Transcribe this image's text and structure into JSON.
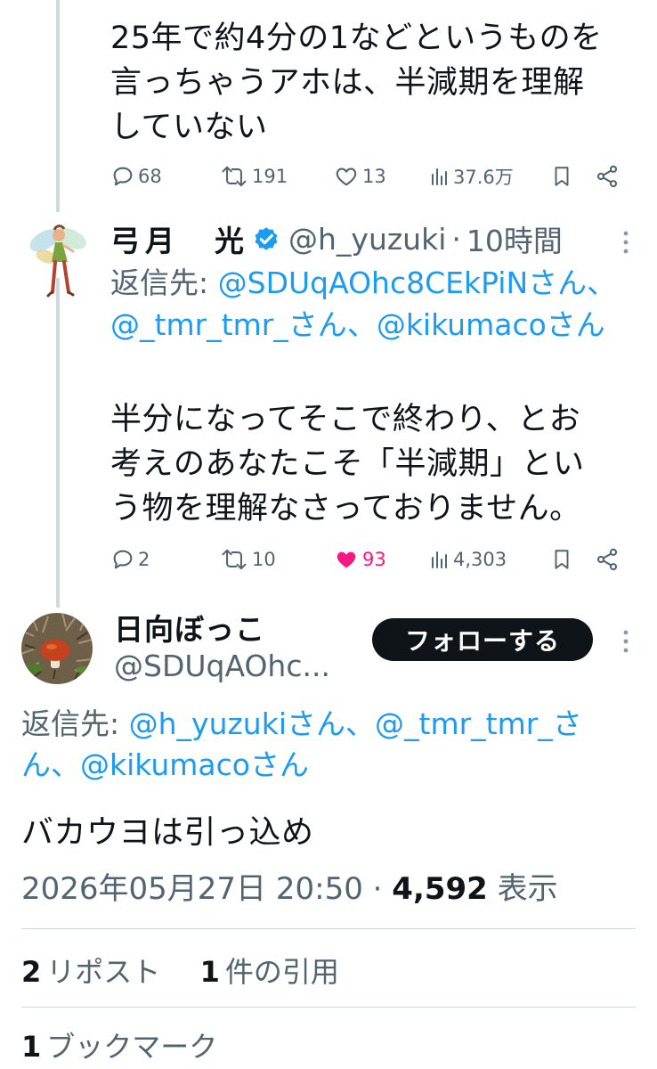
{
  "tweet1": {
    "body_lines": [
      "25年で約4分の1などというものを",
      "言っちゃうアホは、半減期を理解",
      "していない"
    ],
    "replies": "68",
    "reposts": "191",
    "likes": "13",
    "views": "37.6万"
  },
  "tweet2": {
    "name": "弓月　光",
    "handle": "@h_yuzuki",
    "dot": "·",
    "time": "10時間",
    "reply_prefix": "返信先:",
    "reply_mentions": [
      "@SDUqAOhc8CEkPiNさん",
      "@_tmr_tmr_さん",
      "@kikumacoさん"
    ],
    "reply_separator": "、",
    "body_lines": [
      "半分になってそこで終わり、とお",
      "考えのあなたこそ「半減期」とい",
      "う物を理解なさっておりません。"
    ],
    "replies": "2",
    "reposts": "10",
    "likes": "93",
    "views": "4,303"
  },
  "tweet3": {
    "name": "日向ぼっこ",
    "handle": "@SDUqAOhc...",
    "follow_label": "フォローする",
    "reply_prefix": "返信先:",
    "reply_mentions": [
      "@h_yuzukiさん",
      "@_tmr_tmr_さん",
      "@kikumacoさん"
    ],
    "reply_separator": "、",
    "body": "バカウヨは引っ込め",
    "date": "2026年05月27日 20:50",
    "dot": "·",
    "views_count": "4,592",
    "views_label": "表示",
    "reposts_count": "2",
    "reposts_label": "リポスト",
    "quotes_count": "1",
    "quotes_label": "件の引用",
    "bookmarks_count": "1",
    "bookmarks_label": "ブックマーク"
  },
  "colors": {
    "accent": "#1d9bf0",
    "like": "#f91880",
    "muted": "#536471",
    "text": "#0f1419"
  }
}
